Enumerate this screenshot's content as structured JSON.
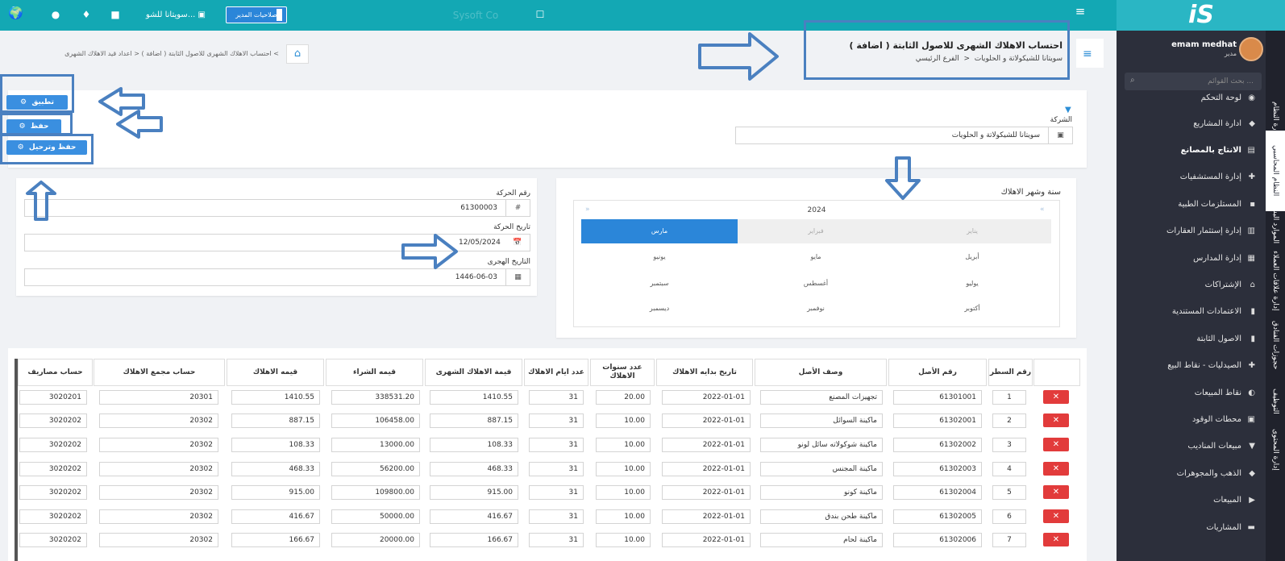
{
  "topbar": {
    "permissions_label": "صلاحيات المدير",
    "company_short": "سويتانا للشو...",
    "search_watermark": "Sysoft Co"
  },
  "sidebar": {
    "user_name": "emam medhat",
    "user_role": "مدير",
    "search_placeholder": "بحث القوائم ...",
    "items": [
      {
        "label": "لوحة التحكم",
        "icon": "dashboard-icon"
      },
      {
        "label": "ادارة المشاريع",
        "icon": "projects-icon"
      },
      {
        "label": "الانتاج بالمصانع",
        "icon": "factory-icon"
      },
      {
        "label": "إدارة المستشفيات",
        "icon": "hospital-icon"
      },
      {
        "label": "المستلزمات الطبية",
        "icon": "medical-icon"
      },
      {
        "label": "إدارة إستثمار العقارات",
        "icon": "building-icon"
      },
      {
        "label": "إدارة المدارس",
        "icon": "school-icon"
      },
      {
        "label": "الإشتراكات",
        "icon": "bank-icon"
      },
      {
        "label": "الاعتمادات المستندية",
        "icon": "document-icon"
      },
      {
        "label": "الاصول الثابتة",
        "icon": "document-icon"
      },
      {
        "label": "الصيدليات - نقاط البيع",
        "icon": "pharmacy-icon"
      },
      {
        "label": "نقاط المبيعات",
        "icon": "pos-icon"
      },
      {
        "label": "محطات الوقود",
        "icon": "fuel-icon"
      },
      {
        "label": "مبيعات المناديب",
        "icon": "cart-icon"
      },
      {
        "label": "الذهب والمجوهرات",
        "icon": "gold-icon"
      },
      {
        "label": "المبيعات",
        "icon": "truck-icon"
      },
      {
        "label": "المشاريات",
        "icon": "purchase-icon"
      }
    ],
    "vtabs": [
      "إدارة النظام",
      "النظام المحاسبي",
      "الموارد البشرية",
      "إدارة علاقات العملاء",
      "حجوزات الفنادق",
      "التوظيف",
      "إدارة المحتوى"
    ]
  },
  "page": {
    "title": "احتساب الاهلاك الشهرى للاصول الثابتة ( اضافة )",
    "subtitle_company": "سويتانا للشيكولاتة و الحلويات",
    "subtitle_branch": "الفرع الرئيسي",
    "breadcrumb_parent": "اعداد قيد الاهلاك الشهرى",
    "breadcrumb_current": "احتساب الاهلاك الشهرى للاصول الثابتة ( اضافة )"
  },
  "filter": {
    "company_label": "الشركة",
    "company_value": "سويتانا للشيكولاتة و الحلويات"
  },
  "actions": {
    "apply": "تطبيق",
    "save": "حفظ",
    "save_post": "حفظ وترحيل"
  },
  "calendar": {
    "label": "سنة وشهر الاهلاك",
    "year": "2024",
    "months": [
      "يناير",
      "فبراير",
      "مارس",
      "أبريل",
      "مايو",
      "يونيو",
      "يوليو",
      "أغسطس",
      "سبتمبر",
      "أكتوبر",
      "نوفمبر",
      "ديسمبر"
    ],
    "selected": "مارس"
  },
  "movement": {
    "number_label": "رقم الحركة",
    "number_value": "61300003",
    "date_label": "تاريخ الحركة",
    "date_value": "12/05/2024",
    "hijri_label": "التاريخ الهجرى",
    "hijri_value": "1446-06-03"
  },
  "table": {
    "headers": [
      "رقم السطر",
      "رقم الأصل",
      "وصف الأصل",
      "تاريخ بدايه الاهلاك",
      "عدد سنوات الاهلاك",
      "عدد ايام الاهلاك",
      "قيمة الاهلاك الشهرى",
      "قيمه الشراء",
      "قيمه الاهلاك",
      "حساب مجمع الاهلاك",
      "حساب مصاريف"
    ],
    "delete_label": "✕",
    "rows": [
      [
        "1",
        "61301001",
        "تجهيزات المصنع",
        "2022-01-01",
        "20.00",
        "31",
        "1410.55",
        "338531.20",
        "1410.55",
        "20301",
        "3020201"
      ],
      [
        "2",
        "61302001",
        "ماكينة السوائل",
        "2022-01-01",
        "10.00",
        "31",
        "887.15",
        "106458.00",
        "887.15",
        "20302",
        "3020202"
      ],
      [
        "3",
        "61302002",
        "ماكينة شوكولاته سائل لونو",
        "2022-01-01",
        "10.00",
        "31",
        "108.33",
        "13000.00",
        "108.33",
        "20302",
        "3020202"
      ],
      [
        "4",
        "61302003",
        "ماكينة المجنس",
        "2022-01-01",
        "10.00",
        "31",
        "468.33",
        "56200.00",
        "468.33",
        "20302",
        "3020202"
      ],
      [
        "5",
        "61302004",
        "ماكينة كونو",
        "2022-01-01",
        "10.00",
        "31",
        "915.00",
        "109800.00",
        "915.00",
        "20302",
        "3020202"
      ],
      [
        "6",
        "61302005",
        "ماكينة طحن بندق",
        "2022-01-01",
        "10.00",
        "31",
        "416.67",
        "50000.00",
        "416.67",
        "20302",
        "3020202"
      ],
      [
        "7",
        "61302006",
        "ماكينة لحام",
        "2022-01-01",
        "10.00",
        "31",
        "166.67",
        "20000.00",
        "166.67",
        "20302",
        "3020202"
      ]
    ]
  },
  "colors": {
    "topbar": "#13a8b4",
    "sidebar": "#2c2f3b",
    "primary": "#2b86d9",
    "danger": "#e23b3b",
    "annotation": "#4a80c0"
  }
}
